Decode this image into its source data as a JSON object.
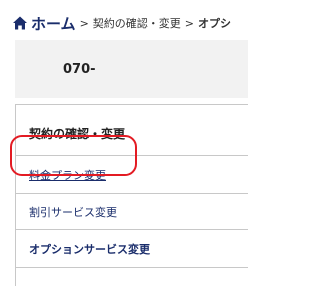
{
  "breadcrumb": {
    "home_icon": "home-icon",
    "home_label": "ホーム",
    "separator": ">",
    "item1": "契約の確認・変更",
    "current": "オプシ"
  },
  "phone": {
    "number": "070-"
  },
  "menu": {
    "title": "契約の確認・変更",
    "items": [
      {
        "label": "料金プラン変更"
      },
      {
        "label": "割引サービス変更"
      },
      {
        "label": "オプションサービス変更"
      }
    ]
  },
  "colors": {
    "link": "#1a2d6b",
    "highlight": "#e31b23",
    "panel_bg": "#f2f2f2",
    "border": "#c8c8c8"
  }
}
